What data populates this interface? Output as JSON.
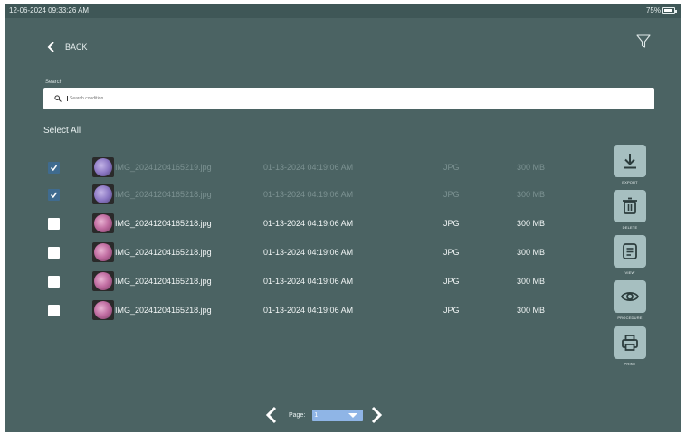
{
  "status_bar": {
    "time": "12-06-2024 09:33:26 AM",
    "battery": "75%"
  },
  "nav": {
    "back_label": "BACK"
  },
  "search": {
    "label": "Search",
    "placeholder": "Search condition"
  },
  "list": {
    "select_all_label": "Select All",
    "rows": [
      {
        "checked": true,
        "name": "IMG_20241204165219.jpg",
        "date": "01-13-2024 04:19:06 AM",
        "type": "JPG",
        "size": "300 MB"
      },
      {
        "checked": true,
        "name": "IMG_20241204165218.jpg",
        "date": "01-13-2024 04:19:06 AM",
        "type": "JPG",
        "size": "300 MB"
      },
      {
        "checked": false,
        "name": "IMG_20241204165218.jpg",
        "date": "01-13-2024 04:19:06 AM",
        "type": "JPG",
        "size": "300 MB"
      },
      {
        "checked": false,
        "name": "IMG_20241204165218.jpg",
        "date": "01-13-2024 04:19:06 AM",
        "type": "JPG",
        "size": "300 MB"
      },
      {
        "checked": false,
        "name": "IMG_20241204165218.jpg",
        "date": "01-13-2024 04:19:06 AM",
        "type": "JPG",
        "size": "300 MB"
      },
      {
        "checked": false,
        "name": "IMG_20241204165218.jpg",
        "date": "01-13-2024 04:19:06 AM",
        "type": "JPG",
        "size": "300 MB"
      }
    ]
  },
  "actions": [
    {
      "label": "EXPORT",
      "icon": "download-icon"
    },
    {
      "label": "DELETE",
      "icon": "trash-icon"
    },
    {
      "label": "VIEW",
      "icon": "document-icon"
    },
    {
      "label": "PROCEDURE",
      "icon": "eye-icon"
    },
    {
      "label": "PRINT",
      "icon": "printer-icon"
    }
  ],
  "pagination": {
    "label": "Page:",
    "current": "1"
  },
  "colors": {
    "background": "#4b6363",
    "action_button": "#a6bfc0",
    "checkbox_checked": "#3f6b8f",
    "page_select": "#8fb5e6"
  }
}
